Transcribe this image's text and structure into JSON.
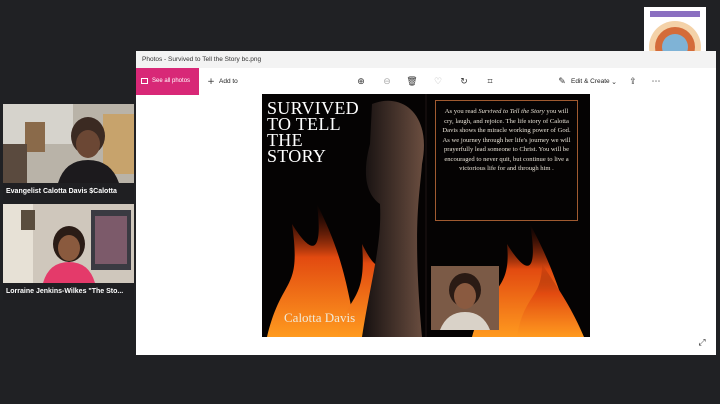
{
  "participants": [
    {
      "name": "Evangelist Calotta Davis $Calotta"
    },
    {
      "name": "Lorraine Jenkins-Wilkes \"The Sto..."
    }
  ],
  "window": {
    "title": "Photos - Survived to Tell the Story bc.png"
  },
  "toolbar": {
    "see_all_label": "See all photos",
    "add_to_label": "Add to",
    "edit_create_label": "Edit & Create",
    "icons": [
      "zoom-in-icon",
      "zoom-out-icon",
      "delete-icon",
      "heart-icon",
      "rotate-icon",
      "crop-icon",
      "share-icon",
      "more-icon"
    ]
  },
  "cover": {
    "title_lines": [
      "SURVIVED",
      "TO TELL",
      "THE",
      "STORY"
    ],
    "author": "Calotta Davis",
    "back_text_pre": "As you read ",
    "back_text_italic": "Survived to Tell the Story",
    "back_text_post": " you will cry, laugh, and rejoice. The life story of Calotta Davis shows the miracle working power of God. As we journey through her life's journey we will prayerfully lead someone to Christ. You will be encouraged to never quit, but continue to live a victorious life for and through him ."
  },
  "colors": {
    "background": "#202124",
    "accent": "#d82877"
  }
}
